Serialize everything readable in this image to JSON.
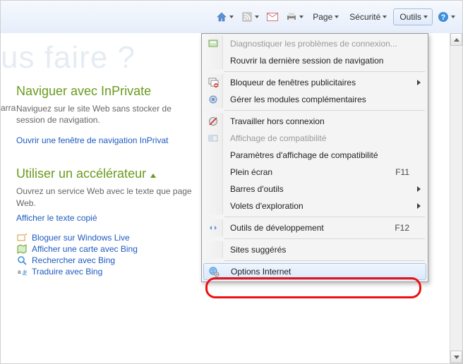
{
  "toolbar": {
    "page_label": "Page",
    "securite_label": "Sécurité",
    "outils_label": "Outils"
  },
  "faded_title": "us faire ?",
  "section1": {
    "title": "Naviguer avec InPrivate",
    "cutword": "arrage",
    "desc": "Naviguez sur le site Web sans stocker de session de navigation.",
    "link": "Ouvrir une fenêtre de navigation InPrivat"
  },
  "section2": {
    "title": "Utiliser un accélérateur",
    "desc": "Ouvrez un service Web avec le texte que page Web.",
    "link": "Afficher le texte copié"
  },
  "accel_links": {
    "blog": "Bloguer sur Windows Live",
    "map": "Afficher une carte avec Bing",
    "search": "Rechercher avec Bing",
    "translate": "Traduire avec Bing"
  },
  "menu": {
    "diag": "Diagnostiquer les problèmes de connexion...",
    "reopen": "Rouvrir la dernière session de navigation",
    "popup": "Bloqueur de fenêtres publicitaires",
    "addons": "Gérer les modules complémentaires",
    "offline": "Travailler hors connexion",
    "compatview": "Affichage de compatibilité",
    "compatparams": "Paramètres d'affichage de compatibilité",
    "fullscreen": "Plein écran",
    "fullscreen_key": "F11",
    "toolbars": "Barres d'outils",
    "panels": "Volets d'exploration",
    "devtools": "Outils de développement",
    "devtools_key": "F12",
    "suggested": "Sites suggérés",
    "inetopts": "Options Internet"
  }
}
